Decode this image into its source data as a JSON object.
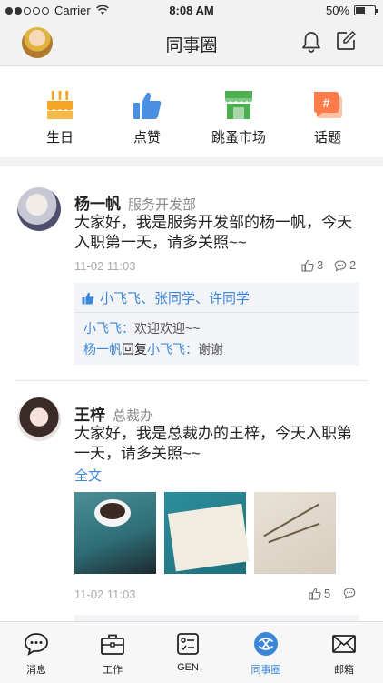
{
  "status_bar": {
    "carrier": "Carrier",
    "time": "8:08 AM",
    "battery": "50%",
    "battery_level": 0.5
  },
  "header": {
    "title": "同事圈"
  },
  "quick_actions": [
    {
      "label": "生日",
      "icon": "birthday-cake-icon"
    },
    {
      "label": "点赞",
      "icon": "thumbs-up-icon"
    },
    {
      "label": "跳蚤市场",
      "icon": "market-stall-icon"
    },
    {
      "label": "话题",
      "icon": "hashtag-icon"
    }
  ],
  "posts": [
    {
      "name": "杨一帆",
      "dept": "服务开发部",
      "text": "大家好，我是服务开发部的杨一帆，今天入职第一天，请多关照~~",
      "time": "11-02 11:03",
      "likes": "3",
      "comments": "2",
      "liked_by": "小飞飞、张同学、许同学",
      "replies": [
        {
          "author": "小飞飞：",
          "text": "欢迎欢迎~~"
        },
        {
          "author": "杨一帆",
          "reply_word": "回复",
          "target": "小飞飞：",
          "text": "谢谢"
        }
      ]
    },
    {
      "name": "王梓",
      "dept": "总裁办",
      "text": "大家好，我是总裁办的王梓，今天入职第一天，请多关照~~",
      "full_text_link": "全文",
      "time": "11-02 11:03",
      "likes": "5"
    }
  ],
  "tab_bar": [
    {
      "label": "消息",
      "icon": "chat-bubble-icon"
    },
    {
      "label": "工作",
      "icon": "briefcase-icon"
    },
    {
      "label": "GEN",
      "icon": "id-card-icon"
    },
    {
      "label": "同事圈",
      "icon": "colleague-circle-icon",
      "active": true
    },
    {
      "label": "邮箱",
      "icon": "envelope-icon"
    }
  ],
  "colors": {
    "accent": "#3b86d9",
    "cake": "#f6a623",
    "like": "#4a90e2",
    "market": "#4caf50",
    "topic": "#ff7b4a"
  }
}
